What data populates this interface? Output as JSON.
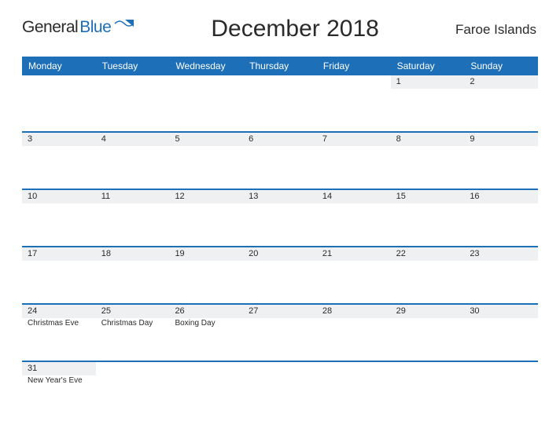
{
  "header": {
    "logo_text_1": "General",
    "logo_text_2": "Blue",
    "title": "December 2018",
    "region": "Faroe Islands"
  },
  "dow": [
    "Monday",
    "Tuesday",
    "Wednesday",
    "Thursday",
    "Friday",
    "Saturday",
    "Sunday"
  ],
  "weeks": [
    [
      {
        "n": "",
        "e": ""
      },
      {
        "n": "",
        "e": ""
      },
      {
        "n": "",
        "e": ""
      },
      {
        "n": "",
        "e": ""
      },
      {
        "n": "",
        "e": ""
      },
      {
        "n": "1",
        "e": ""
      },
      {
        "n": "2",
        "e": ""
      }
    ],
    [
      {
        "n": "3",
        "e": ""
      },
      {
        "n": "4",
        "e": ""
      },
      {
        "n": "5",
        "e": ""
      },
      {
        "n": "6",
        "e": ""
      },
      {
        "n": "7",
        "e": ""
      },
      {
        "n": "8",
        "e": ""
      },
      {
        "n": "9",
        "e": ""
      }
    ],
    [
      {
        "n": "10",
        "e": ""
      },
      {
        "n": "11",
        "e": ""
      },
      {
        "n": "12",
        "e": ""
      },
      {
        "n": "13",
        "e": ""
      },
      {
        "n": "14",
        "e": ""
      },
      {
        "n": "15",
        "e": ""
      },
      {
        "n": "16",
        "e": ""
      }
    ],
    [
      {
        "n": "17",
        "e": ""
      },
      {
        "n": "18",
        "e": ""
      },
      {
        "n": "19",
        "e": ""
      },
      {
        "n": "20",
        "e": ""
      },
      {
        "n": "21",
        "e": ""
      },
      {
        "n": "22",
        "e": ""
      },
      {
        "n": "23",
        "e": ""
      }
    ],
    [
      {
        "n": "24",
        "e": "Christmas Eve"
      },
      {
        "n": "25",
        "e": "Christmas Day"
      },
      {
        "n": "26",
        "e": "Boxing Day"
      },
      {
        "n": "27",
        "e": ""
      },
      {
        "n": "28",
        "e": ""
      },
      {
        "n": "29",
        "e": ""
      },
      {
        "n": "30",
        "e": ""
      }
    ],
    [
      {
        "n": "31",
        "e": "New Year's Eve"
      },
      {
        "n": "",
        "e": ""
      },
      {
        "n": "",
        "e": ""
      },
      {
        "n": "",
        "e": ""
      },
      {
        "n": "",
        "e": ""
      },
      {
        "n": "",
        "e": ""
      },
      {
        "n": "",
        "e": ""
      }
    ]
  ]
}
